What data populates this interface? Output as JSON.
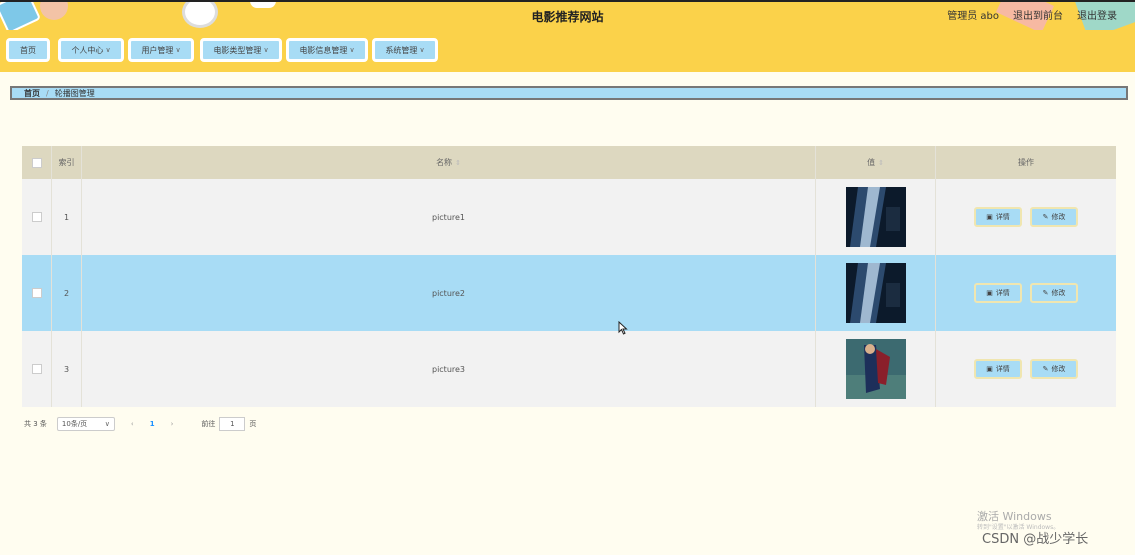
{
  "header": {
    "title": "电影推荐网站",
    "admin_label": "管理员 abo",
    "back_front": "退出到前台",
    "logout": "退出登录"
  },
  "nav": {
    "items": [
      {
        "label": "首页",
        "dropdown": false
      },
      {
        "label": "个人中心",
        "dropdown": true
      },
      {
        "label": "用户管理",
        "dropdown": true
      },
      {
        "label": "电影类型管理",
        "dropdown": true
      },
      {
        "label": "电影信息管理",
        "dropdown": true
      },
      {
        "label": "系统管理",
        "dropdown": true
      }
    ]
  },
  "breadcrumb": {
    "home": "首页",
    "separator": "/",
    "current": "轮播图管理"
  },
  "table": {
    "columns": {
      "index": "索引",
      "name": "名称",
      "value": "值",
      "ops": "操作"
    },
    "rows": [
      {
        "index": "1",
        "name": "picture1",
        "thumb": "dark-blue"
      },
      {
        "index": "2",
        "name": "picture2",
        "thumb": "dark-blue"
      },
      {
        "index": "3",
        "name": "picture3",
        "thumb": "superhero"
      }
    ],
    "detail_label": "详情",
    "edit_label": "修改"
  },
  "pagination": {
    "total": "共 3 条",
    "page_size": "10条/页",
    "current_page": "1",
    "goto_label": "前往",
    "goto_value": "1",
    "page_unit": "页"
  },
  "watermark": {
    "activate": "激活 Windows",
    "activate_hint": "转到\"设置\"以激活 Windows。"
  },
  "credit": "CSDN @战少学长",
  "colors": {
    "header_bg": "#fbd24a",
    "accent_blue": "#a8dcf5",
    "page_bg": "#fffdf0"
  }
}
